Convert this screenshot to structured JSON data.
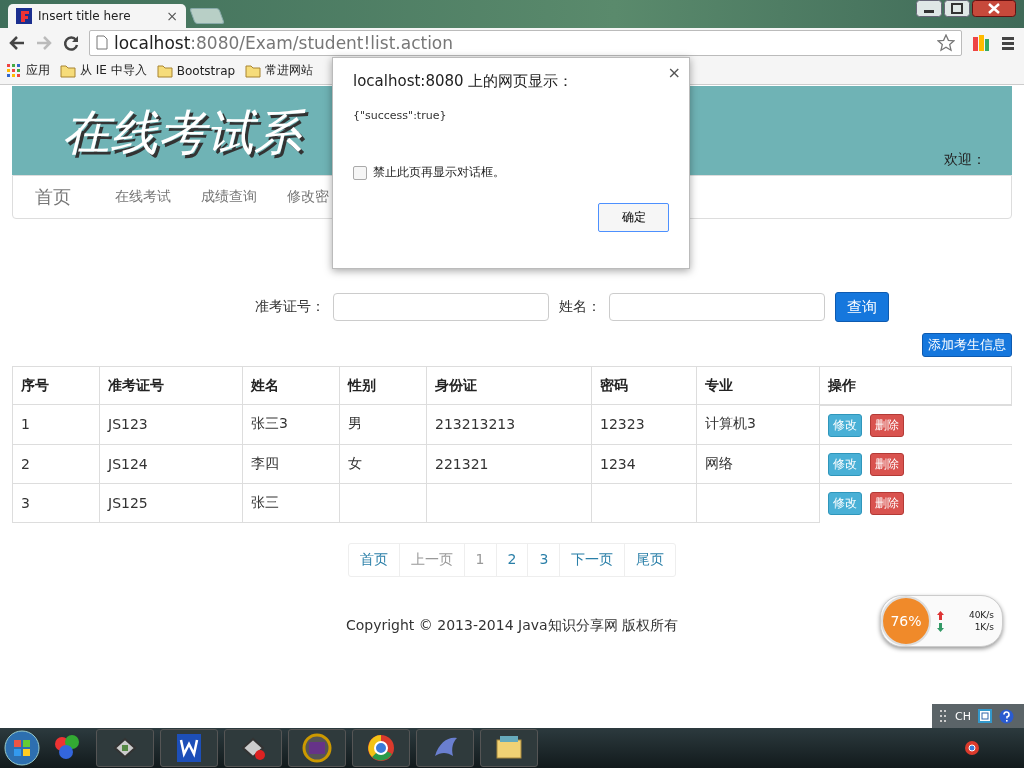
{
  "browser": {
    "tab": {
      "title": "Insert title here",
      "close": "×"
    },
    "address": {
      "host": "localhost",
      "rest": ":8080/Exam/student!list.action"
    },
    "bookmarks": [
      {
        "label": "应用",
        "kind": "apps"
      },
      {
        "label": "从 IE 中导入",
        "kind": "folder"
      },
      {
        "label": "Bootstrap",
        "kind": "folder"
      },
      {
        "label": "常进网站",
        "kind": "folder"
      }
    ]
  },
  "header": {
    "title": "在线考试系",
    "welcome": "欢迎："
  },
  "nav": {
    "brand": "首页",
    "items": [
      {
        "label": "在线考试"
      },
      {
        "label": "成绩查询"
      },
      {
        "label": "修改密"
      }
    ]
  },
  "search": {
    "fields": [
      {
        "label": "准考证号："
      },
      {
        "label": "姓名："
      }
    ],
    "button": "查询"
  },
  "add_button": "添加考生信息",
  "table": {
    "columns": [
      "序号",
      "准考证号",
      "姓名",
      "性别",
      "身份证",
      "密码",
      "专业",
      "操作"
    ],
    "rows": [
      {
        "cells": [
          "1",
          "JS123",
          "张三3",
          "男",
          "213213213",
          "12323",
          "计算机3"
        ],
        "actions": [
          "修改",
          "删除"
        ]
      },
      {
        "cells": [
          "2",
          "JS124",
          "李四",
          "女",
          "221321",
          "1234",
          "网络"
        ],
        "actions": [
          "修改",
          "删除"
        ]
      },
      {
        "cells": [
          "3",
          "JS125",
          "张三",
          "",
          "",
          "",
          ""
        ],
        "actions": [
          "修改",
          "删除"
        ]
      }
    ]
  },
  "pagination": [
    {
      "label": "首页",
      "disabled": false
    },
    {
      "label": "上一页",
      "disabled": true
    },
    {
      "label": "1",
      "disabled": true
    },
    {
      "label": "2",
      "disabled": false
    },
    {
      "label": "3",
      "disabled": false
    },
    {
      "label": "下一页",
      "disabled": false
    },
    {
      "label": "尾页",
      "disabled": false
    }
  ],
  "footer": "Copyright © 2013-2014 Java知识分享网 版权所有",
  "dialog": {
    "title": "localhost:8080 上的网页显示：",
    "close": "×",
    "message": "{\"success\":true}",
    "checkbox": {
      "label": "禁止此页再显示对话框。",
      "checked": false
    },
    "ok": "确定"
  },
  "net_widget": {
    "percent": "76%",
    "upload": "40K/s",
    "download": "1K/s"
  },
  "taskbar": {
    "language": "CH"
  }
}
